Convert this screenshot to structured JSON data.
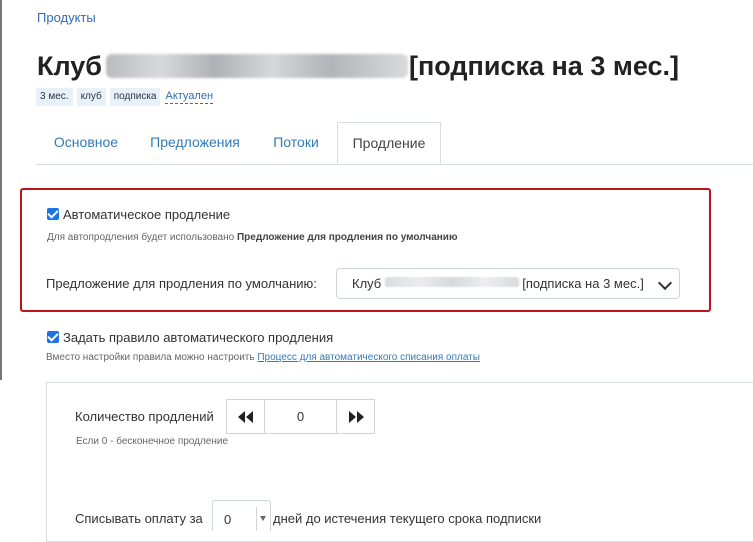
{
  "breadcrumb": {
    "label": "Продукты"
  },
  "title": {
    "prefix": "Клуб",
    "suffix": "[подписка на 3 мес.]"
  },
  "tags": [
    "3 мес.",
    "клуб",
    "подписка"
  ],
  "status": "Актуален",
  "tabs": [
    "Основное",
    "Предложения",
    "Потоки",
    "Продление"
  ],
  "active_tab": "Продление",
  "auto_renewal": {
    "checked": true,
    "label": "Автоматическое продление",
    "help_prefix": "Для автопродления будет использовано",
    "help_strong": "Предложение для продления по умолчанию",
    "default_offer_label": "Предложение для продления по умолчанию:",
    "default_offer_value_prefix": "Клуб",
    "default_offer_value_suffix": "[подписка на 3 мес.]"
  },
  "rule": {
    "checked": true,
    "label": "Задать правило автоматического продления",
    "help_prefix": "Вместо настройки правила можно настроить",
    "help_link": "Процесс для автоматического списания оплаты"
  },
  "renewal_count": {
    "label": "Количество продлений",
    "value": "0",
    "help": "Если 0 - бесконечное продление"
  },
  "charge_days": {
    "label_prefix": "Списывать оплату за",
    "value": "0",
    "label_suffix": "дней до истечения текущего срока подписки"
  },
  "colors": {
    "accent": "#337ab7",
    "highlight_border": "#c0101a",
    "checkbox": "#1a73e8"
  },
  "icons": {
    "previous": "double-left-arrow-icon",
    "next": "double-right-arrow-icon",
    "select": "chevron-down-icon"
  }
}
